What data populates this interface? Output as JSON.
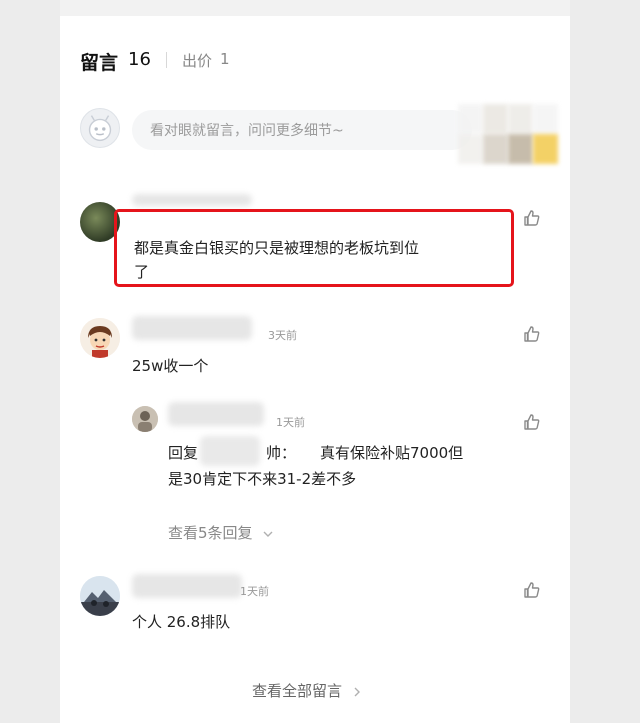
{
  "tabs": {
    "comments_label": "留言",
    "comments_count": "16",
    "offers_label": "出价",
    "offers_count": "1"
  },
  "input": {
    "placeholder": "看对眼就留言，问问更多细节~"
  },
  "comments": [
    {
      "author_visible": "",
      "time": "",
      "text_line1": "都是真金白银买的只是被理想的老板坑到位",
      "text_line2": "了",
      "highlighted": true
    },
    {
      "author_visible": "",
      "time": "3天前",
      "text_line1": "25w收一个",
      "reply": {
        "time": "1天前",
        "prefix": "回复",
        "suffix": "帅：",
        "text_line1": "真有保险补贴7000但",
        "text_line2": "是30肯定下不来31-2差不多"
      },
      "view_replies": "查看5条回复"
    },
    {
      "author_visible": "",
      "time": "1天前",
      "text_line1": "个人 26.8排队"
    }
  ],
  "footer": {
    "view_all": "查看全部留言"
  },
  "colors": {
    "highlight": "#e5141b",
    "muted": "#999999"
  },
  "icons": [
    "like-icon",
    "chevron-down-icon",
    "chevron-right-icon"
  ]
}
